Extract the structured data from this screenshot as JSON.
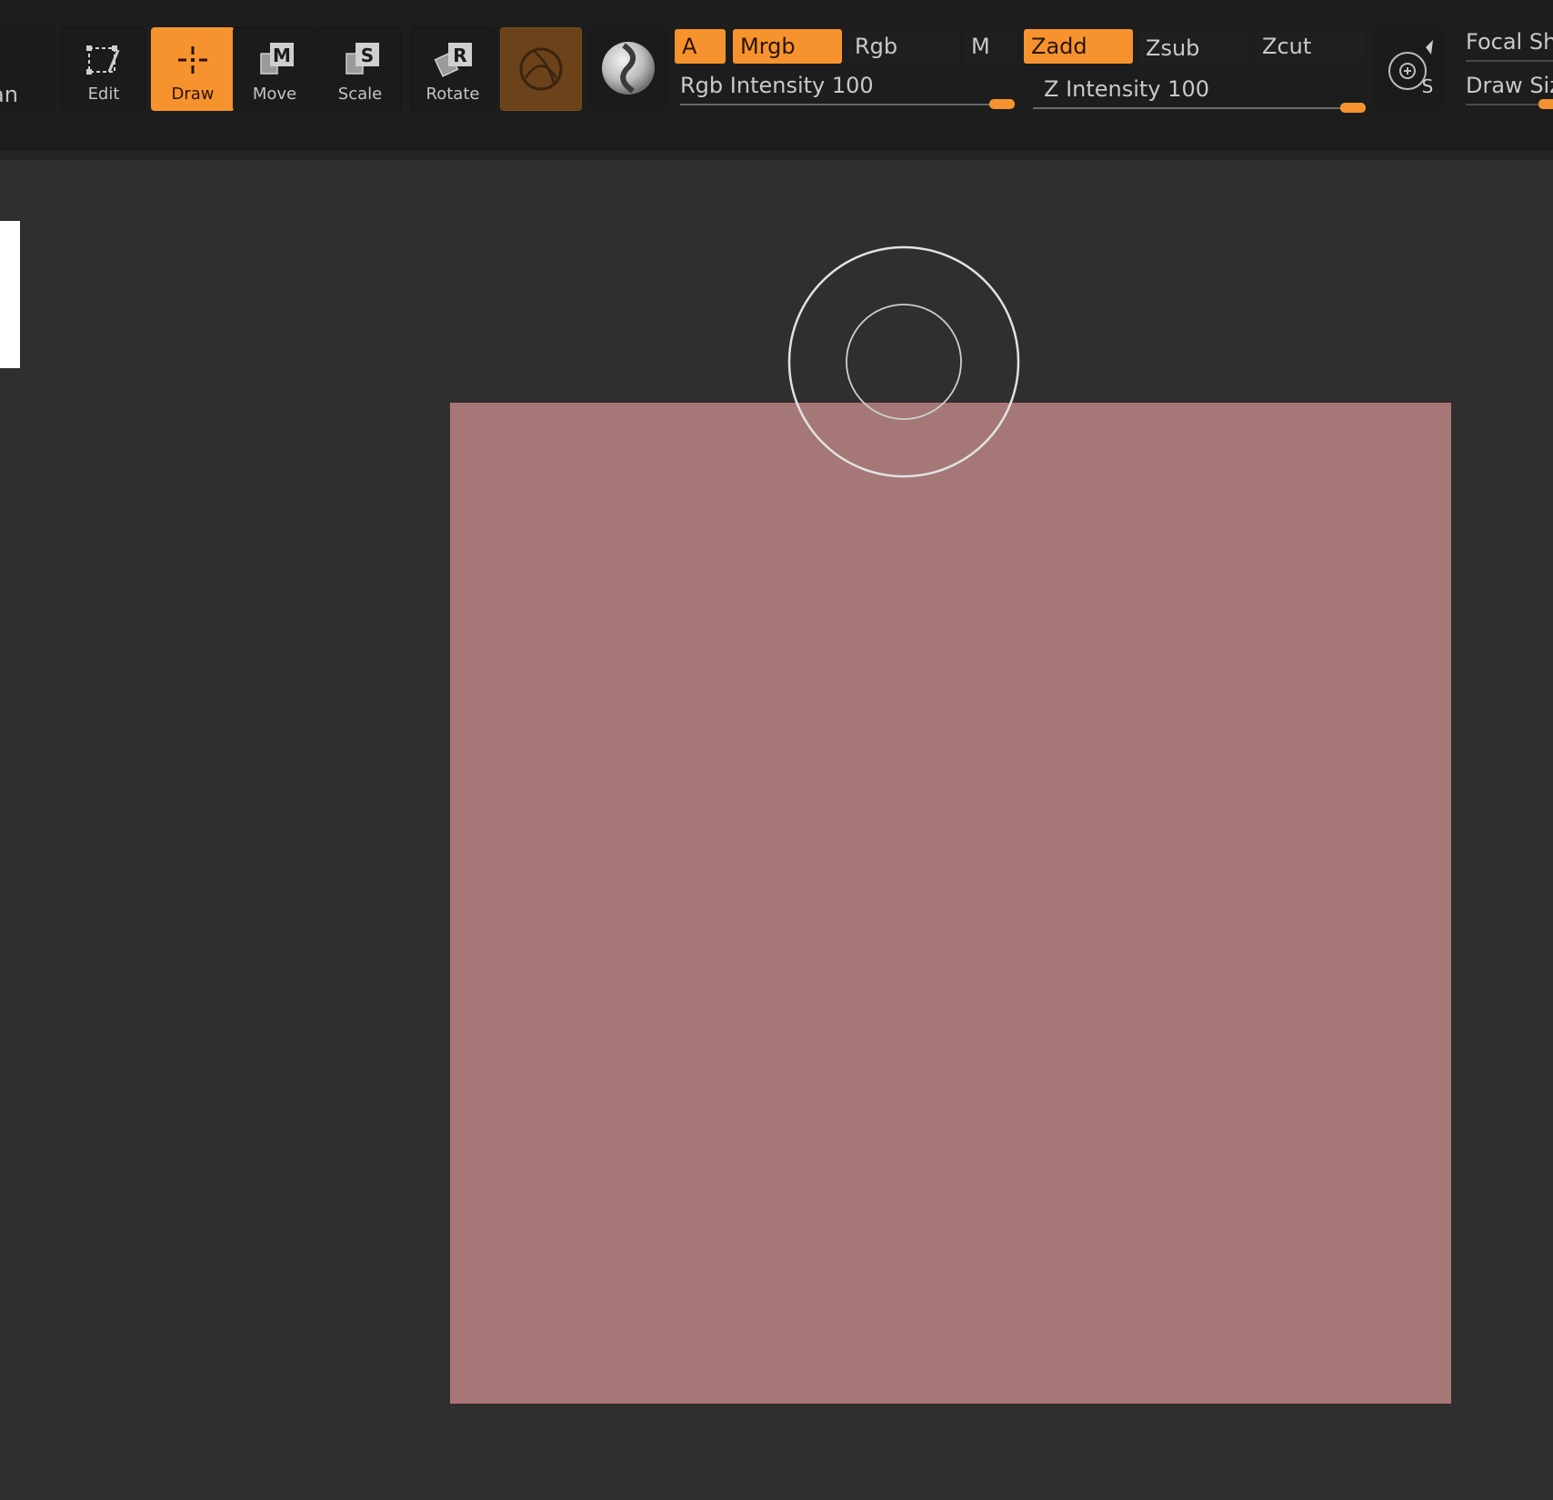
{
  "toolbar": {
    "cut_label": "an",
    "tools": [
      {
        "name": "edit",
        "label": "Edit",
        "active": false
      },
      {
        "name": "draw",
        "label": "Draw",
        "active": true
      },
      {
        "name": "move",
        "label": "Move",
        "active": false
      },
      {
        "name": "scale",
        "label": "Scale",
        "active": false
      },
      {
        "name": "rotate",
        "label": "Rotate",
        "active": false
      }
    ],
    "material": {
      "icon": "material-sphere-icon",
      "color": "#6b4219"
    },
    "sphere": {
      "icon": "sphere-brush-icon"
    },
    "color_modes": {
      "a": "A",
      "mrgb": "Mrgb",
      "rgb": "Rgb",
      "m": "M"
    },
    "rgb_intensity": {
      "label": "Rgb Intensity",
      "value": "100",
      "fraction": 1.0
    },
    "z_modes": {
      "zadd": "Zadd",
      "zsub": "Zsub",
      "zcut": "Zcut"
    },
    "z_intensity": {
      "label": "Z Intensity",
      "value": "100",
      "fraction": 1.0
    },
    "focal_icon": "focal-shift-icon",
    "focal_label": "Focal Shi",
    "draw_size_label": "Draw Siz"
  },
  "canvas": {
    "plane_color": "#a57777",
    "background_color": "#2f2f2f"
  },
  "colors": {
    "accent": "#f7932e",
    "toolbar_bg": "#1d1d1d"
  }
}
